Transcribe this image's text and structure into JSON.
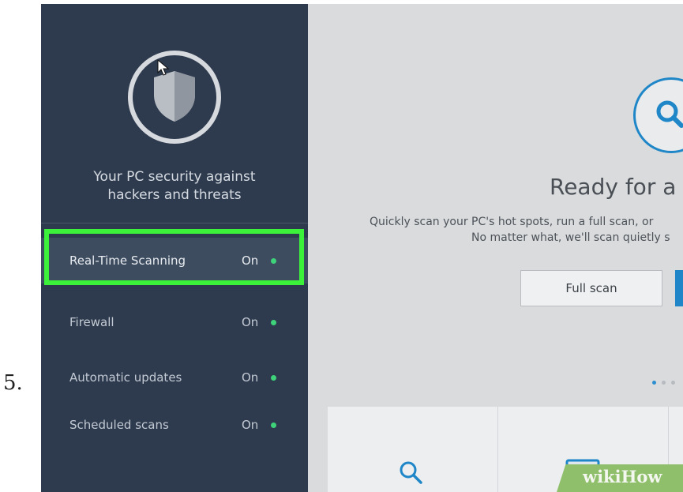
{
  "step_number": "5.",
  "sidebar": {
    "tagline": "Your PC security against\nhackers and threats",
    "items": [
      {
        "label": "Real-Time Scanning",
        "status": "On"
      },
      {
        "label": "Firewall",
        "status": "On"
      },
      {
        "label": "Automatic updates",
        "status": "On"
      },
      {
        "label": "Scheduled scans",
        "status": "On"
      }
    ]
  },
  "main": {
    "title": "Ready for a v",
    "description_line1": "Quickly scan your PC's hot spots, run a full scan, or",
    "description_line2": "No matter what, we'll scan quietly s",
    "full_scan_label": "Full scan"
  },
  "watermark": "wikiHow",
  "colors": {
    "sidebar_bg": "#2e3b4e",
    "highlight": "#3cf13a",
    "status_dot": "#3ed37a",
    "accent_blue": "#1f86c8"
  },
  "icons": [
    "shield-icon",
    "cursor-icon",
    "search-icon",
    "window-icon"
  ]
}
